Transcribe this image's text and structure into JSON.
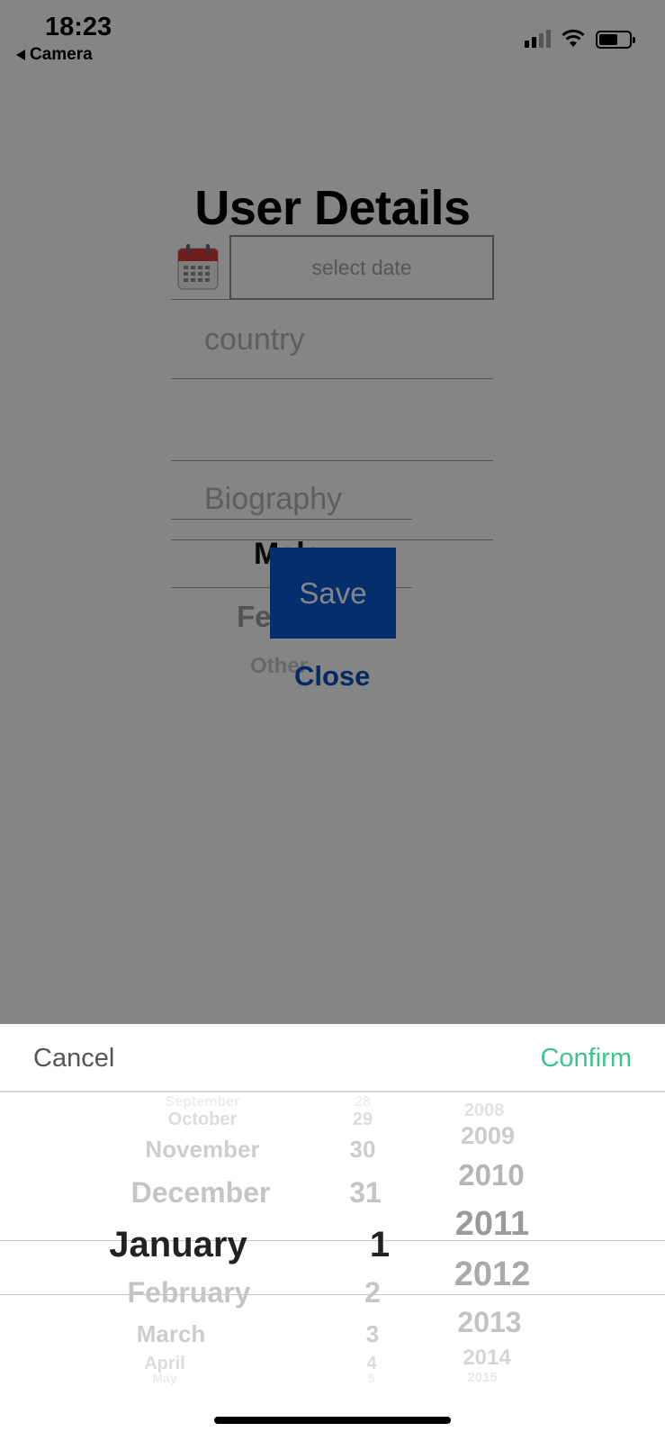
{
  "status_bar": {
    "time": "18:23",
    "back_label": "Camera"
  },
  "form": {
    "title": "User Details",
    "date_placeholder": "select date",
    "country_placeholder": "country",
    "biography_placeholder": "Biography",
    "gender_options": [
      "Male",
      "Female",
      "Other"
    ],
    "gender_selected": "Male",
    "save_label": "Save",
    "close_label": "Close"
  },
  "picker": {
    "cancel_label": "Cancel",
    "confirm_label": "Confirm",
    "months": [
      "September",
      "October",
      "November",
      "December",
      "January",
      "February",
      "March",
      "April",
      "May"
    ],
    "days": [
      "28",
      "29",
      "30",
      "31",
      "1",
      "2",
      "3",
      "4",
      "5"
    ],
    "years": [
      "2008",
      "2009",
      "2010",
      "2011",
      "2012",
      "2013",
      "2014",
      "2015"
    ],
    "selected": {
      "month": "January",
      "day": "1",
      "year": "2011"
    }
  },
  "colors": {
    "save_button": "#0a58d0",
    "close_link": "#0d4fbf",
    "confirm": "#3cc48f"
  }
}
